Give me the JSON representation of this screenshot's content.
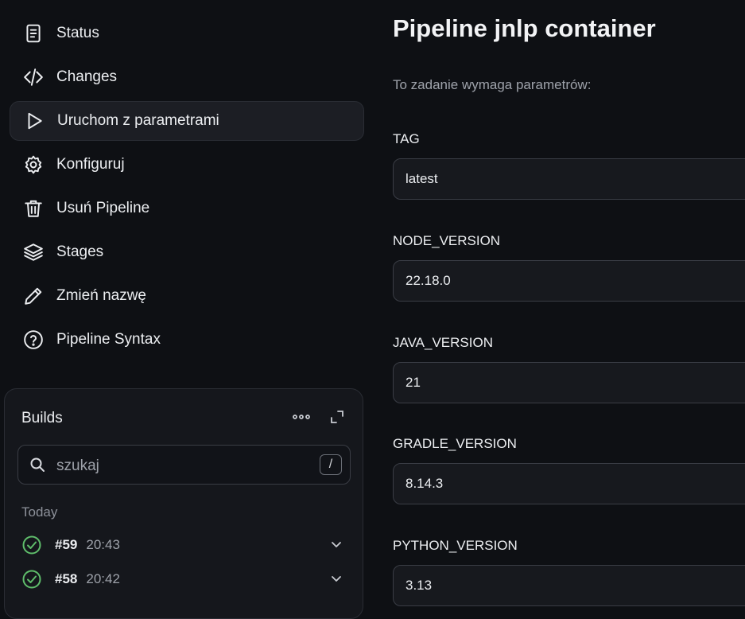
{
  "sidebar": {
    "items": [
      {
        "label": "Status",
        "icon": "document-icon"
      },
      {
        "label": "Changes",
        "icon": "code-icon"
      },
      {
        "label": "Uruchom z parametrami",
        "icon": "play-icon",
        "active": true
      },
      {
        "label": "Konfiguruj",
        "icon": "gear-icon"
      },
      {
        "label": "Usuń Pipeline",
        "icon": "trash-icon"
      },
      {
        "label": "Stages",
        "icon": "layers-icon"
      },
      {
        "label": "Zmień nazwę",
        "icon": "pencil-icon"
      },
      {
        "label": "Pipeline Syntax",
        "icon": "help-icon"
      }
    ]
  },
  "builds": {
    "title": "Builds",
    "search_placeholder": "szukaj",
    "search_shortcut": "/",
    "group_label": "Today",
    "items": [
      {
        "number": "#59",
        "time": "20:43",
        "status": "success"
      },
      {
        "number": "#58",
        "time": "20:42",
        "status": "success"
      }
    ]
  },
  "main": {
    "title": "Pipeline jnlp container",
    "subtitle": "To zadanie wymaga parametrów:",
    "params": [
      {
        "name": "TAG",
        "value": "latest"
      },
      {
        "name": "NODE_VERSION",
        "value": "22.18.0"
      },
      {
        "name": "JAVA_VERSION",
        "value": "21"
      },
      {
        "name": "GRADLE_VERSION",
        "value": "8.14.3"
      },
      {
        "name": "PYTHON_VERSION",
        "value": "3.13"
      }
    ]
  },
  "colors": {
    "background": "#0e1014",
    "panel": "#15171c",
    "success": "#5fbd6b"
  }
}
